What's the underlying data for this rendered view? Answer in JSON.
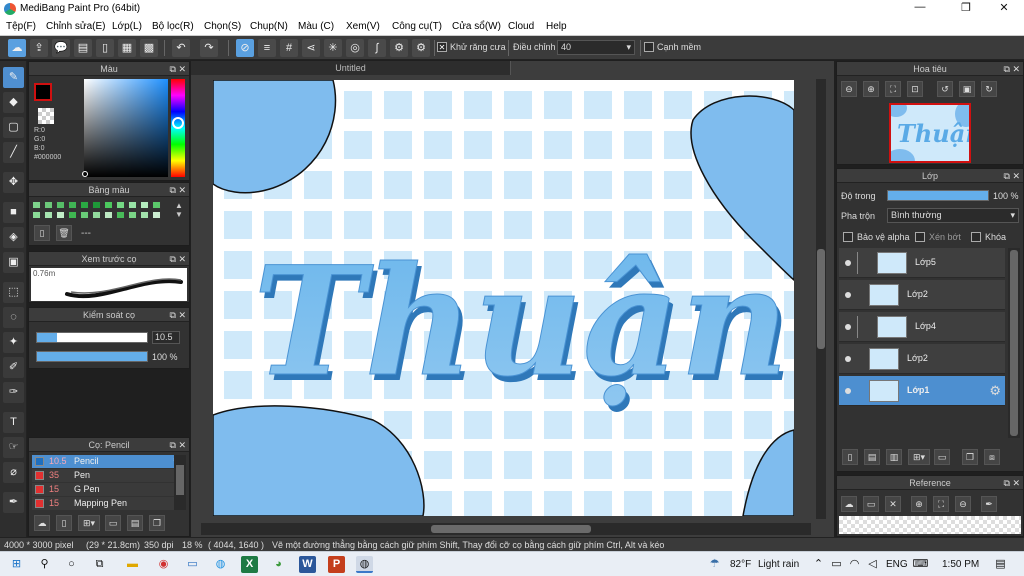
{
  "window": {
    "title": "MediBang Paint Pro (64bit)",
    "min_glyph": "—",
    "max_glyph": "❐",
    "close_glyph": "✕"
  },
  "menu": [
    "Tệp(F)",
    "Chỉnh sửa(E)",
    "Lớp(L)",
    "Bộ lọc(R)",
    "Chọn(S)",
    "Chụp(N)",
    "Màu (C)",
    "Xem(V)",
    "Công cụ(T)",
    "Cửa sổ(W)",
    "Cloud",
    "Help"
  ],
  "toolbar": {
    "antialias_label": "Khử răng cưa",
    "antialias_checked": true,
    "correction_label": "Điều chỉnh",
    "correction_value": "40",
    "edge_label": "Cạnh mềm",
    "edge_checked": false
  },
  "color_panel": {
    "title": "Màu",
    "r": "R:0",
    "g": "G:0",
    "b": "B:0",
    "hex": "#000000"
  },
  "palette_panel": {
    "title": "Bảng màu",
    "name": "---",
    "swatches": [
      "#7ed38c",
      "#6cc87a",
      "#56be68",
      "#40b455",
      "#2aa843",
      "#1e9838",
      "#4cc85e",
      "#74d884",
      "#98e3a6",
      "#b4ecbe",
      "#5bc96b",
      "#8adb97",
      "#a6e4b0",
      "#c2edc8",
      "#3fb651",
      "#69cb78",
      "#92db9d",
      "#bde9c3",
      "#48bb59",
      "#7ad486",
      "#a3e1ac",
      "#cdeed2"
    ]
  },
  "brush_preview": {
    "title": "Xem trước cọ",
    "size": "0.76m"
  },
  "brush_control": {
    "title": "Kiểm soát cọ",
    "size_value": "10.5",
    "size_fill": 0.18,
    "opacity_value": "100 %",
    "opacity_fill": 1.0
  },
  "brush_list": {
    "title": "Cọ: Pencil",
    "items": [
      {
        "size": "10.5",
        "name": "Pencil",
        "color": "#1e6fbf",
        "active": true
      },
      {
        "size": "35",
        "name": "Pen",
        "color": "#e23030",
        "active": false
      },
      {
        "size": "15",
        "name": "G Pen",
        "color": "#e23030",
        "active": false
      },
      {
        "size": "15",
        "name": "Mapping Pen",
        "color": "#e23030",
        "active": false
      }
    ]
  },
  "canvas": {
    "tab_title": "Untitled",
    "artwork_text": "Thuận"
  },
  "navigator": {
    "title": "Hoa tiêu"
  },
  "layer_panel": {
    "title": "Lớp",
    "opacity_label": "Độ trong",
    "opacity_value": "100 %",
    "opacity_fill": 1.0,
    "blend_label": "Pha trộn",
    "blend_value": "Bình thường",
    "protect_alpha": "Bảo vệ alpha",
    "clipping": "Xén bớt",
    "lock": "Khóa",
    "layers": [
      {
        "name": "Lớp5",
        "active": false,
        "indent": true
      },
      {
        "name": "Lớp2",
        "active": false,
        "indent": false
      },
      {
        "name": "Lớp4",
        "active": false,
        "indent": true
      },
      {
        "name": "Lớp2",
        "active": false,
        "indent": false
      },
      {
        "name": "Lớp1",
        "active": true,
        "indent": false
      }
    ]
  },
  "reference_panel": {
    "title": "Reference"
  },
  "status": {
    "size": "4000 * 3000 pixel",
    "physical": "(29 * 21.8cm)",
    "dpi": "350 dpi",
    "zoom": "18 %",
    "cursor": "( 4044, 1640 )",
    "hint": "Vẽ một đường thẳng bằng cách giữ phím Shift, Thay đổi cỡ cọ bằng cách giữ phím Ctrl, Alt và kéo"
  },
  "taskbar": {
    "weather_temp": "82°F",
    "weather_text": "Light rain",
    "lang": "ENG",
    "time": "1:50 PM"
  }
}
